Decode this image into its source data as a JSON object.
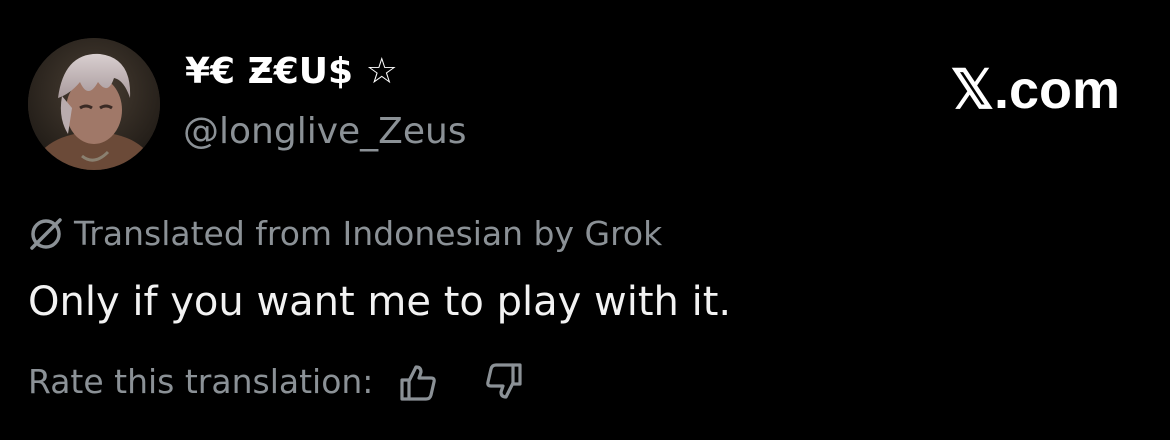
{
  "author": {
    "display_name": "¥€ Ƶ€U$ ☆",
    "handle": "@longlive_Zeus",
    "avatar_icon": "profile-avatar"
  },
  "brand": {
    "label": "𝕏.com"
  },
  "translation": {
    "icon": "grok-slash-icon",
    "notice": "Translated from Indonesian by Grok"
  },
  "tweet": {
    "text": "Only if you want me to play with it."
  },
  "rating": {
    "prompt": "Rate this translation:",
    "thumbs_up_icon": "thumbs-up-icon",
    "thumbs_down_icon": "thumbs-down-icon"
  },
  "colors": {
    "background": "#000000",
    "primary_text": "#ffffff",
    "secondary_text": "#8b9196"
  }
}
